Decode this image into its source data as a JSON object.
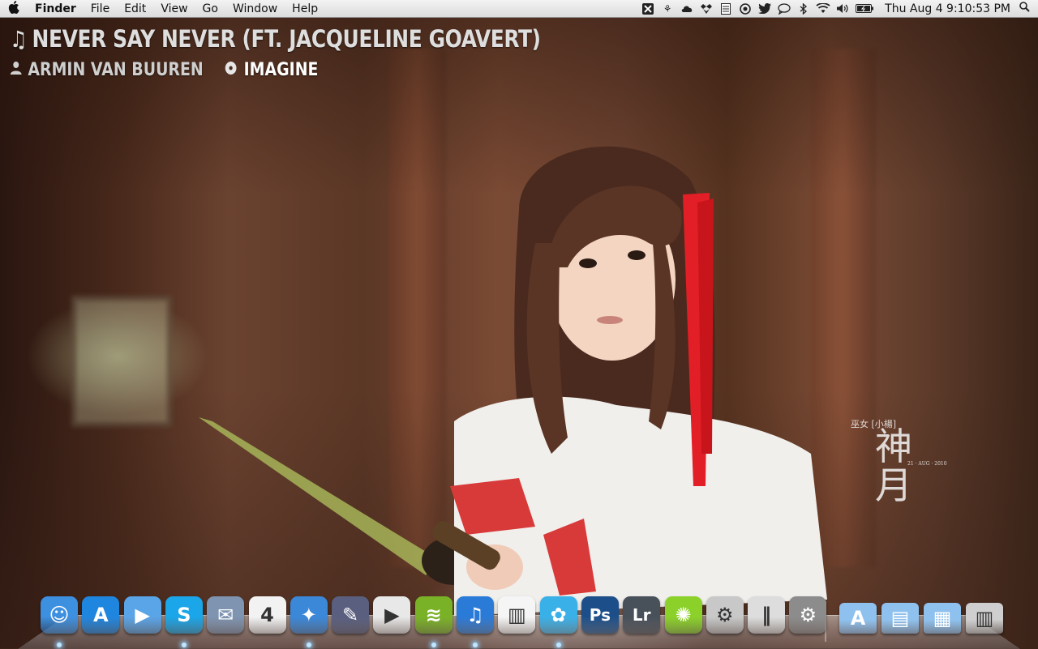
{
  "menubar": {
    "apple_icon": "apple-logo-icon",
    "app_name": "Finder",
    "items": [
      "File",
      "Edit",
      "View",
      "Go",
      "Window",
      "Help"
    ],
    "status_icons": [
      "x-app-icon",
      "butterfly-icon",
      "cloud-icon",
      "dropbox-icon",
      "notes-icon",
      "record-icon",
      "twitter-icon",
      "speech-bubble-icon",
      "bluetooth-icon",
      "wifi-icon",
      "volume-icon",
      "battery-icon"
    ],
    "clock": "Thu Aug 4  9:10:53 PM",
    "spotlight_icon": "magnifier-icon"
  },
  "now_playing": {
    "title": "NEVER SAY NEVER (FT. JACQUELINE GOAVERT)",
    "artist": "ARMIN VAN BUUREN",
    "album": "IMAGINE"
  },
  "wallpaper": {
    "signature_text": "巫女 [小楊]",
    "signature_small": "21 · AUG · 2010"
  },
  "dock": {
    "apps": [
      {
        "name": "Finder",
        "icon": "finder-icon",
        "color": "#3d8fe0",
        "glyph": "☺",
        "running": true
      },
      {
        "name": "App Store",
        "icon": "app-store-icon",
        "color": "#1f86e0",
        "glyph": "A",
        "running": false
      },
      {
        "name": "FaceTime",
        "icon": "facetime-icon",
        "color": "#5aa4e8",
        "glyph": "▶",
        "running": false
      },
      {
        "name": "Skype",
        "icon": "skype-icon",
        "color": "#1aa6e8",
        "glyph": "S",
        "running": true
      },
      {
        "name": "Mail",
        "icon": "mail-icon",
        "color": "#7f94b0",
        "glyph": "✉",
        "running": false
      },
      {
        "name": "iCal",
        "icon": "calendar-icon",
        "color": "#f2f2f2",
        "glyph": "4",
        "running": false
      },
      {
        "name": "Safari",
        "icon": "safari-icon",
        "color": "#3b87d8",
        "glyph": "✦",
        "running": true
      },
      {
        "name": "Script Editor",
        "icon": "script-editor-icon",
        "color": "#5a5f80",
        "glyph": "✎",
        "running": false
      },
      {
        "name": "QuickTime",
        "icon": "quicktime-icon",
        "color": "#e8e8e8",
        "glyph": "▶",
        "running": false
      },
      {
        "name": "Spotify",
        "icon": "spotify-icon",
        "color": "#7ab227",
        "glyph": "≋",
        "running": true
      },
      {
        "name": "iTunes",
        "icon": "itunes-icon",
        "color": "#2a7ad8",
        "glyph": "♫",
        "running": true
      },
      {
        "name": "Piano",
        "icon": "piano-icon",
        "color": "#f5f5f5",
        "glyph": "▥",
        "running": false
      },
      {
        "name": "Twitter",
        "icon": "twitter-icon",
        "color": "#3ab0e8",
        "glyph": "✿",
        "running": true
      },
      {
        "name": "Photoshop",
        "icon": "photoshop-icon",
        "color": "#1c4f8a",
        "glyph": "Ps",
        "running": false
      },
      {
        "name": "Lightroom",
        "icon": "lightroom-icon",
        "color": "#48505a",
        "glyph": "Lr",
        "running": false
      },
      {
        "name": "LimeChat",
        "icon": "lime-icon",
        "color": "#8bd12a",
        "glyph": "✺",
        "running": false
      },
      {
        "name": "Automator",
        "icon": "automator-icon",
        "color": "#c8c8c8",
        "glyph": "⚙",
        "running": false
      },
      {
        "name": "Parallels",
        "icon": "parallels-icon",
        "color": "#dddddd",
        "glyph": "‖",
        "running": false
      },
      {
        "name": "System Preferences",
        "icon": "system-preferences-icon",
        "color": "#8c8c8c",
        "glyph": "⚙",
        "running": false
      }
    ],
    "stacks": [
      {
        "name": "Applications",
        "icon": "applications-folder-icon",
        "color": "#8fc1ee",
        "glyph": "A"
      },
      {
        "name": "Documents",
        "icon": "documents-folder-icon",
        "color": "#8fc1ee",
        "glyph": "▤"
      },
      {
        "name": "Downloads",
        "icon": "downloads-folder-icon",
        "color": "#8fc1ee",
        "glyph": "▦"
      },
      {
        "name": "Trash",
        "icon": "trash-icon",
        "color": "#cfcfcf",
        "glyph": "▥"
      }
    ]
  }
}
